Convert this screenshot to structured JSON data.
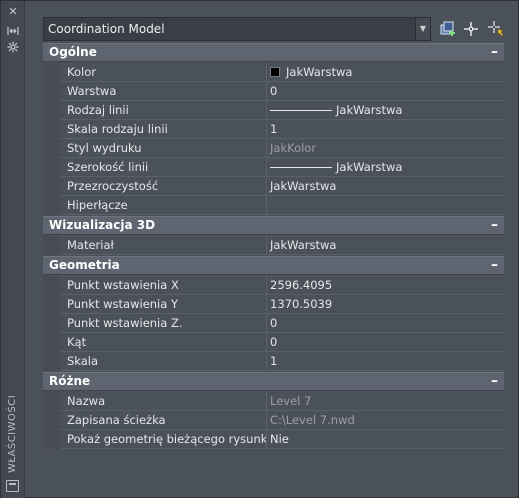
{
  "strip": {
    "title": "WŁAŚCIWOŚCI",
    "icons": [
      "close-icon",
      "autohide-icon",
      "settings-icon",
      "menu-icon"
    ]
  },
  "selector": {
    "value": "Coordination Model"
  },
  "toolbar": {
    "icons": [
      "toggle-pickadd-icon",
      "select-objects-icon",
      "quick-select-icon"
    ]
  },
  "colors": {
    "background": "#4b515b",
    "section": "#5f6570",
    "text": "#e6e6e6",
    "dim_text": "#9a9ea6"
  },
  "sections": [
    {
      "title": "Ogólne",
      "collapse": "–",
      "rows": [
        {
          "name": "Kolor",
          "value": "JakWarstwa",
          "kind": "color"
        },
        {
          "name": "Warstwa",
          "value": "0"
        },
        {
          "name": "Rodzaj linii",
          "value": "JakWarstwa",
          "kind": "line"
        },
        {
          "name": "Skala rodzaju linii",
          "value": "1"
        },
        {
          "name": "Styl wydruku",
          "value": "JakKolor",
          "dim": true
        },
        {
          "name": "Szerokość linii",
          "value": "JakWarstwa",
          "kind": "line"
        },
        {
          "name": "Przezroczystość",
          "value": "JakWarstwa"
        },
        {
          "name": "Hiperłącze",
          "value": ""
        }
      ]
    },
    {
      "title": "Wizualizacja 3D",
      "collapse": "–",
      "rows": [
        {
          "name": "Materiał",
          "value": "JakWarstwa"
        }
      ]
    },
    {
      "title": "Geometria",
      "collapse": "–",
      "rows": [
        {
          "name": "Punkt wstawienia X",
          "value": "2596.4095"
        },
        {
          "name": "Punkt wstawienia Y",
          "value": "1370.5039"
        },
        {
          "name": "Punkt wstawienia Z.",
          "value": "0"
        },
        {
          "name": "Kąt",
          "value": "0"
        },
        {
          "name": "Skala",
          "value": "1"
        }
      ]
    },
    {
      "title": "Różne",
      "collapse": "–",
      "rows": [
        {
          "name": "Nazwa",
          "value": "Level 7",
          "dim": true
        },
        {
          "name": "Zapisana ścieżka",
          "value": "C:\\Level 7.nwd",
          "dim": true
        },
        {
          "name": "Pokaż geometrię bieżącego rysunku",
          "value": "Nie"
        }
      ]
    }
  ]
}
